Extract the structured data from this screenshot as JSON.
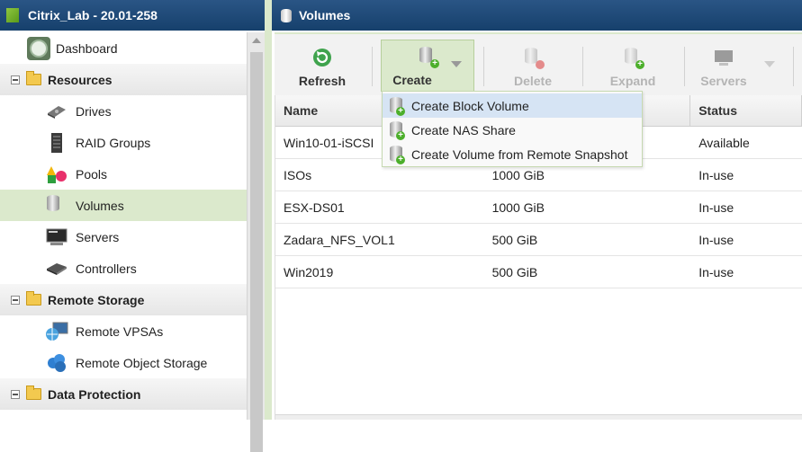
{
  "left_panel": {
    "title": "Citrix_Lab - 20.01-258",
    "dashboard": "Dashboard",
    "sections": [
      {
        "label": "Resources",
        "items": [
          "Drives",
          "RAID Groups",
          "Pools",
          "Volumes",
          "Servers",
          "Controllers"
        ]
      },
      {
        "label": "Remote Storage",
        "items": [
          "Remote VPSAs",
          "Remote Object Storage"
        ]
      },
      {
        "label": "Data Protection",
        "items": []
      }
    ],
    "selected_item": "Volumes"
  },
  "right_panel": {
    "title": "Volumes",
    "toolbar": {
      "refresh": "Refresh",
      "create": "Create",
      "delete": "Delete",
      "expand": "Expand",
      "servers": "Servers"
    },
    "create_menu": {
      "items": [
        "Create Block Volume",
        "Create NAS Share",
        "Create Volume from Remote Snapshot"
      ],
      "highlighted": "Create Block Volume"
    },
    "table": {
      "columns": [
        "Name",
        "",
        "Status"
      ],
      "rows": [
        {
          "name": "Win10-01-iSCSI",
          "size": "",
          "status": "Available"
        },
        {
          "name": "ISOs",
          "size": "1000 GiB",
          "status": "In-use"
        },
        {
          "name": "ESX-DS01",
          "size": "1000 GiB",
          "status": "In-use"
        },
        {
          "name": "Zadara_NFS_VOL1",
          "size": "500 GiB",
          "status": "In-use"
        },
        {
          "name": "Win2019",
          "size": "500 GiB",
          "status": "In-use"
        }
      ]
    }
  },
  "colors": {
    "header_blue": "#1f4a79",
    "selection_green": "#dbe9cc",
    "menu_highlight": "#d6e4f4"
  }
}
